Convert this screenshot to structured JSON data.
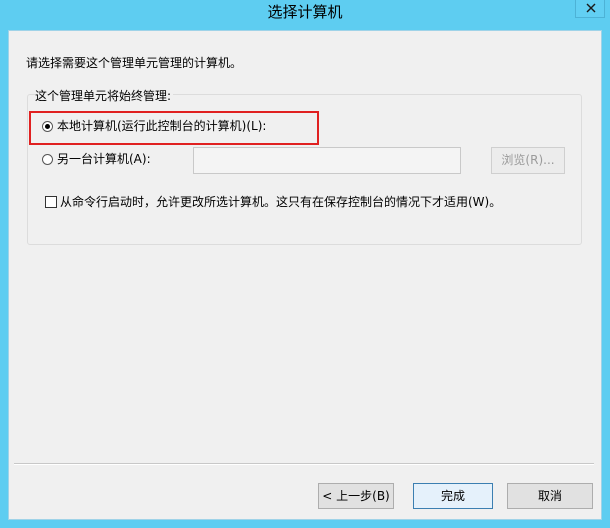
{
  "window": {
    "title": "选择计算机"
  },
  "dialog": {
    "instruction": "请选择需要这个管理单元管理的计算机。",
    "group_label": "这个管理单元将始终管理:",
    "radio_local_label": "本地计算机(运行此控制台的计算机)(L):",
    "radio_local_checked": true,
    "radio_other_label": "另一台计算机(A):",
    "radio_other_checked": false,
    "other_computer_value": "",
    "browse_label": "浏览(R)...",
    "checkbox_label": "从命令行启动时，允许更改所选计算机。这只有在保存控制台的情况下才适用(W)。",
    "checkbox_checked": false
  },
  "footer": {
    "back_label": "< 上一步(B)",
    "finish_label": "完成",
    "cancel_label": "取消"
  },
  "colors": {
    "title_bar": "#5ecdf1",
    "highlight_border": "#e02020",
    "dialog_background": "#f0f0f0"
  },
  "icons": {
    "close": "close-icon"
  }
}
